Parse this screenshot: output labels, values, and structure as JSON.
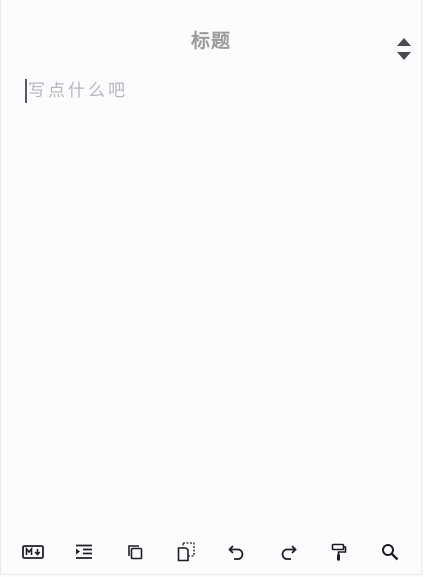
{
  "note": {
    "title": "标题",
    "body_placeholder": "写点什么吧"
  },
  "toolbar": {
    "buttons": [
      {
        "name": "markdown",
        "icon": "markdown-icon"
      },
      {
        "name": "indent",
        "icon": "indent-icon"
      },
      {
        "name": "copy",
        "icon": "copy-icon"
      },
      {
        "name": "paste",
        "icon": "paste-icon"
      },
      {
        "name": "undo",
        "icon": "undo-icon"
      },
      {
        "name": "redo",
        "icon": "redo-icon"
      },
      {
        "name": "format-painter",
        "icon": "paint-roller-icon"
      },
      {
        "name": "search",
        "icon": "search-icon"
      }
    ]
  },
  "colors": {
    "background": "#fdfbfe",
    "icon": "#1f1e24",
    "title_text": "#9b9a9c",
    "placeholder_text": "#b8b6bc"
  }
}
